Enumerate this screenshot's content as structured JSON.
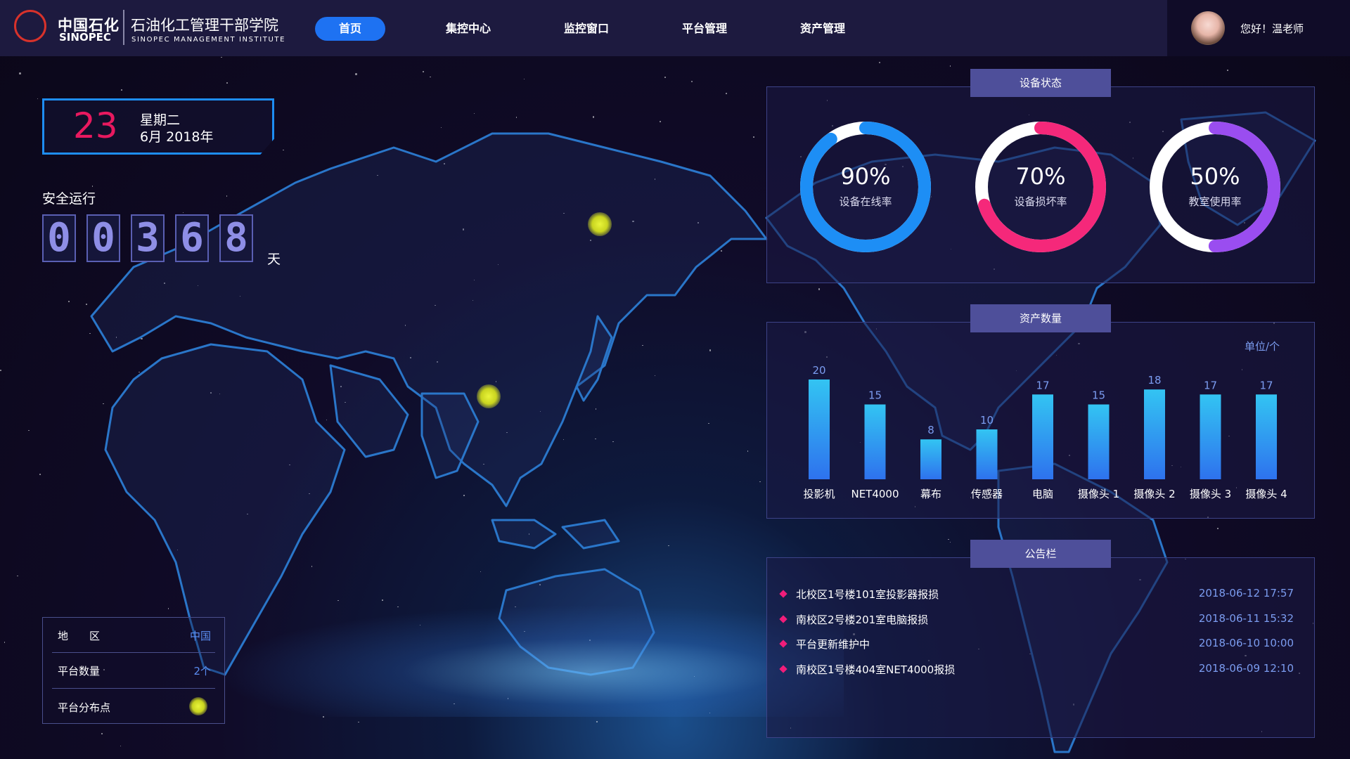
{
  "brand": {
    "logo_cn": "中国石化",
    "logo_en": "SINOPEC",
    "institute_cn": "石油化工管理干部学院",
    "institute_en": "SINOPEC MANAGEMENT INSTITUTE"
  },
  "nav": {
    "items": [
      {
        "label": "首页",
        "active": true
      },
      {
        "label": "集控中心",
        "active": false
      },
      {
        "label": "监控窗口",
        "active": false
      },
      {
        "label": "平台管理",
        "active": false
      },
      {
        "label": "资产管理",
        "active": false
      }
    ]
  },
  "user": {
    "greeting": "您好！温老师"
  },
  "date": {
    "day": "23",
    "weekday": "星期二",
    "month_year": "6月 2018年"
  },
  "safe_run": {
    "label": "安全运行",
    "digits": [
      "0",
      "0",
      "3",
      "6",
      "8"
    ],
    "unit": "天"
  },
  "region": {
    "rows": [
      {
        "key": "地　　区",
        "value": "中国"
      },
      {
        "key": "平台数量",
        "value": "2个"
      },
      {
        "key": "平台分布点",
        "value": ""
      }
    ]
  },
  "device_status": {
    "title": "设备状态",
    "donuts": [
      {
        "percent": 90,
        "label_pct": "90%",
        "label": "设备在线率",
        "colors": [
          "#1d8ef5",
          "#19c6f5"
        ]
      },
      {
        "percent": 70,
        "label_pct": "70%",
        "label": "设备损坏率",
        "colors": [
          "#f5287a",
          "#f55a9a"
        ]
      },
      {
        "percent": 50,
        "label_pct": "50%",
        "label": "教室使用率",
        "colors": [
          "#9a4df0",
          "#b86cf5"
        ]
      }
    ]
  },
  "asset_count": {
    "title": "资产数量",
    "unit": "单位/个",
    "chart_data": {
      "type": "bar",
      "categories": [
        "投影机",
        "NET4000",
        "幕布",
        "传感器",
        "电脑",
        "摄像头 1",
        "摄像头 2",
        "摄像头 3",
        "摄像头 4"
      ],
      "values": [
        20,
        15,
        8,
        10,
        17,
        15,
        18,
        17,
        17
      ],
      "ylim": [
        0,
        20
      ],
      "grid": false
    }
  },
  "notices": {
    "title": "公告栏",
    "items": [
      {
        "text": "北校区1号楼101室投影器报损",
        "time": "2018-06-12 17:57"
      },
      {
        "text": "南校区2号楼201室电脑报损",
        "time": "2018-06-11 15:32"
      },
      {
        "text": "平台更新维护中",
        "time": "2018-06-10 10:00"
      },
      {
        "text": "南校区1号楼404室NET4000报损",
        "time": "2018-06-09 12:10"
      }
    ]
  },
  "colors": {
    "accent": "#1e72f2",
    "date_red": "#e8195f",
    "panel_title": "#4e4f9a",
    "bar": "#2a8cf0",
    "marker": "#d8e02a"
  }
}
